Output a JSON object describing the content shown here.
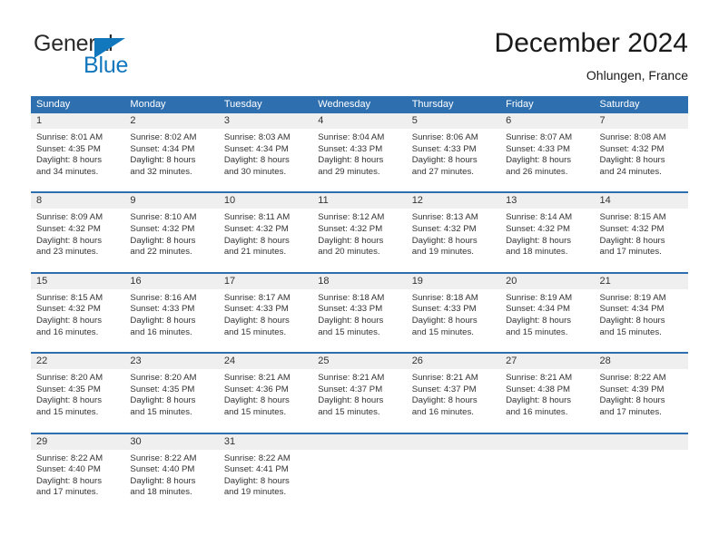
{
  "brand": {
    "name_top": "General",
    "name_bottom": "Blue",
    "color_blue": "#1278be",
    "color_dark": "#2b2b2b"
  },
  "header": {
    "title": "December 2024",
    "subtitle": "Ohlungen, France"
  },
  "theme": {
    "header_blue": "#2e6fb0",
    "daynum_band": "#efefef",
    "text": "#333333"
  },
  "weekdays": [
    "Sunday",
    "Monday",
    "Tuesday",
    "Wednesday",
    "Thursday",
    "Friday",
    "Saturday"
  ],
  "weeks": [
    {
      "days": [
        {
          "num": "1",
          "l1": "Sunrise: 8:01 AM",
          "l2": "Sunset: 4:35 PM",
          "l3": "Daylight: 8 hours",
          "l4": "and 34 minutes."
        },
        {
          "num": "2",
          "l1": "Sunrise: 8:02 AM",
          "l2": "Sunset: 4:34 PM",
          "l3": "Daylight: 8 hours",
          "l4": "and 32 minutes."
        },
        {
          "num": "3",
          "l1": "Sunrise: 8:03 AM",
          "l2": "Sunset: 4:34 PM",
          "l3": "Daylight: 8 hours",
          "l4": "and 30 minutes."
        },
        {
          "num": "4",
          "l1": "Sunrise: 8:04 AM",
          "l2": "Sunset: 4:33 PM",
          "l3": "Daylight: 8 hours",
          "l4": "and 29 minutes."
        },
        {
          "num": "5",
          "l1": "Sunrise: 8:06 AM",
          "l2": "Sunset: 4:33 PM",
          "l3": "Daylight: 8 hours",
          "l4": "and 27 minutes."
        },
        {
          "num": "6",
          "l1": "Sunrise: 8:07 AM",
          "l2": "Sunset: 4:33 PM",
          "l3": "Daylight: 8 hours",
          "l4": "and 26 minutes."
        },
        {
          "num": "7",
          "l1": "Sunrise: 8:08 AM",
          "l2": "Sunset: 4:32 PM",
          "l3": "Daylight: 8 hours",
          "l4": "and 24 minutes."
        }
      ]
    },
    {
      "days": [
        {
          "num": "8",
          "l1": "Sunrise: 8:09 AM",
          "l2": "Sunset: 4:32 PM",
          "l3": "Daylight: 8 hours",
          "l4": "and 23 minutes."
        },
        {
          "num": "9",
          "l1": "Sunrise: 8:10 AM",
          "l2": "Sunset: 4:32 PM",
          "l3": "Daylight: 8 hours",
          "l4": "and 22 minutes."
        },
        {
          "num": "10",
          "l1": "Sunrise: 8:11 AM",
          "l2": "Sunset: 4:32 PM",
          "l3": "Daylight: 8 hours",
          "l4": "and 21 minutes."
        },
        {
          "num": "11",
          "l1": "Sunrise: 8:12 AM",
          "l2": "Sunset: 4:32 PM",
          "l3": "Daylight: 8 hours",
          "l4": "and 20 minutes."
        },
        {
          "num": "12",
          "l1": "Sunrise: 8:13 AM",
          "l2": "Sunset: 4:32 PM",
          "l3": "Daylight: 8 hours",
          "l4": "and 19 minutes."
        },
        {
          "num": "13",
          "l1": "Sunrise: 8:14 AM",
          "l2": "Sunset: 4:32 PM",
          "l3": "Daylight: 8 hours",
          "l4": "and 18 minutes."
        },
        {
          "num": "14",
          "l1": "Sunrise: 8:15 AM",
          "l2": "Sunset: 4:32 PM",
          "l3": "Daylight: 8 hours",
          "l4": "and 17 minutes."
        }
      ]
    },
    {
      "days": [
        {
          "num": "15",
          "l1": "Sunrise: 8:15 AM",
          "l2": "Sunset: 4:32 PM",
          "l3": "Daylight: 8 hours",
          "l4": "and 16 minutes."
        },
        {
          "num": "16",
          "l1": "Sunrise: 8:16 AM",
          "l2": "Sunset: 4:33 PM",
          "l3": "Daylight: 8 hours",
          "l4": "and 16 minutes."
        },
        {
          "num": "17",
          "l1": "Sunrise: 8:17 AM",
          "l2": "Sunset: 4:33 PM",
          "l3": "Daylight: 8 hours",
          "l4": "and 15 minutes."
        },
        {
          "num": "18",
          "l1": "Sunrise: 8:18 AM",
          "l2": "Sunset: 4:33 PM",
          "l3": "Daylight: 8 hours",
          "l4": "and 15 minutes."
        },
        {
          "num": "19",
          "l1": "Sunrise: 8:18 AM",
          "l2": "Sunset: 4:33 PM",
          "l3": "Daylight: 8 hours",
          "l4": "and 15 minutes."
        },
        {
          "num": "20",
          "l1": "Sunrise: 8:19 AM",
          "l2": "Sunset: 4:34 PM",
          "l3": "Daylight: 8 hours",
          "l4": "and 15 minutes."
        },
        {
          "num": "21",
          "l1": "Sunrise: 8:19 AM",
          "l2": "Sunset: 4:34 PM",
          "l3": "Daylight: 8 hours",
          "l4": "and 15 minutes."
        }
      ]
    },
    {
      "days": [
        {
          "num": "22",
          "l1": "Sunrise: 8:20 AM",
          "l2": "Sunset: 4:35 PM",
          "l3": "Daylight: 8 hours",
          "l4": "and 15 minutes."
        },
        {
          "num": "23",
          "l1": "Sunrise: 8:20 AM",
          "l2": "Sunset: 4:35 PM",
          "l3": "Daylight: 8 hours",
          "l4": "and 15 minutes."
        },
        {
          "num": "24",
          "l1": "Sunrise: 8:21 AM",
          "l2": "Sunset: 4:36 PM",
          "l3": "Daylight: 8 hours",
          "l4": "and 15 minutes."
        },
        {
          "num": "25",
          "l1": "Sunrise: 8:21 AM",
          "l2": "Sunset: 4:37 PM",
          "l3": "Daylight: 8 hours",
          "l4": "and 15 minutes."
        },
        {
          "num": "26",
          "l1": "Sunrise: 8:21 AM",
          "l2": "Sunset: 4:37 PM",
          "l3": "Daylight: 8 hours",
          "l4": "and 16 minutes."
        },
        {
          "num": "27",
          "l1": "Sunrise: 8:21 AM",
          "l2": "Sunset: 4:38 PM",
          "l3": "Daylight: 8 hours",
          "l4": "and 16 minutes."
        },
        {
          "num": "28",
          "l1": "Sunrise: 8:22 AM",
          "l2": "Sunset: 4:39 PM",
          "l3": "Daylight: 8 hours",
          "l4": "and 17 minutes."
        }
      ]
    },
    {
      "days": [
        {
          "num": "29",
          "l1": "Sunrise: 8:22 AM",
          "l2": "Sunset: 4:40 PM",
          "l3": "Daylight: 8 hours",
          "l4": "and 17 minutes."
        },
        {
          "num": "30",
          "l1": "Sunrise: 8:22 AM",
          "l2": "Sunset: 4:40 PM",
          "l3": "Daylight: 8 hours",
          "l4": "and 18 minutes."
        },
        {
          "num": "31",
          "l1": "Sunrise: 8:22 AM",
          "l2": "Sunset: 4:41 PM",
          "l3": "Daylight: 8 hours",
          "l4": "and 19 minutes."
        },
        {
          "num": "",
          "l1": "",
          "l2": "",
          "l3": "",
          "l4": ""
        },
        {
          "num": "",
          "l1": "",
          "l2": "",
          "l3": "",
          "l4": ""
        },
        {
          "num": "",
          "l1": "",
          "l2": "",
          "l3": "",
          "l4": ""
        },
        {
          "num": "",
          "l1": "",
          "l2": "",
          "l3": "",
          "l4": ""
        }
      ]
    }
  ]
}
